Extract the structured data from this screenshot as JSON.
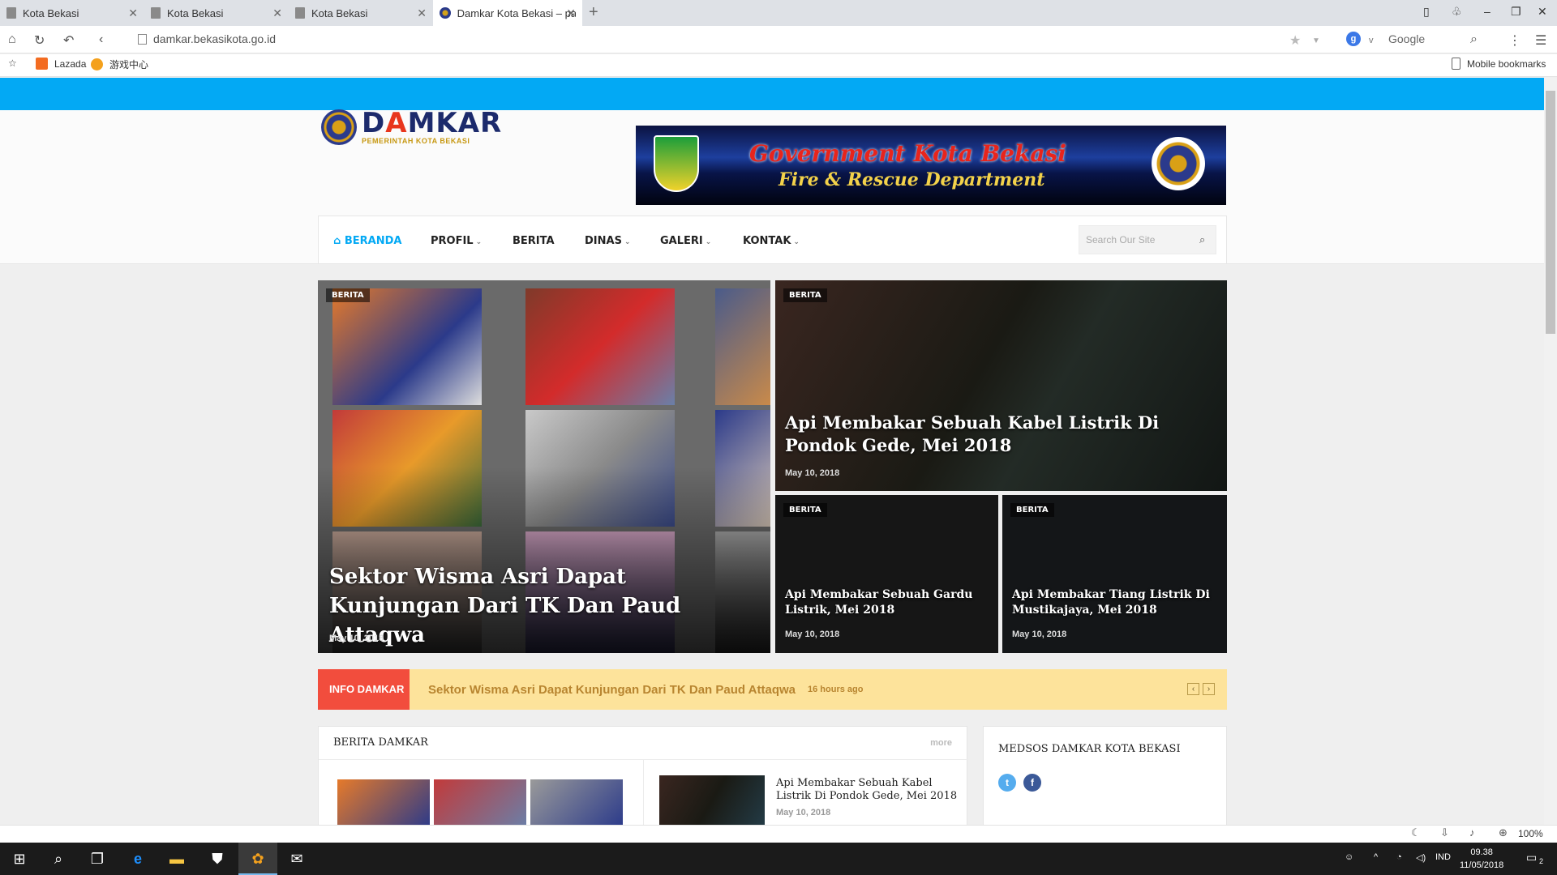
{
  "browser": {
    "tabs": [
      {
        "title": "Kota Bekasi"
      },
      {
        "title": "Kota Bekasi"
      },
      {
        "title": "Kota Bekasi"
      },
      {
        "title": "Damkar Kota Bekasi – pantang"
      }
    ],
    "url": "damkar.bekasikota.go.id",
    "search_engine": "Google",
    "bookmarks": [
      {
        "label": "Lazada"
      },
      {
        "label": "游戏中心"
      }
    ],
    "mobile_bookmarks": "Mobile bookmarks",
    "zoom": "100%"
  },
  "site": {
    "logo_title": "DAMKAR",
    "logo_subtitle": "PEMERINTAH KOTA BEKASI",
    "banner_line1": "Government Kota Bekasi",
    "banner_line2": "Fire & Rescue Department",
    "nav": [
      {
        "label": "BERANDA",
        "active": true,
        "dropdown": false
      },
      {
        "label": "PROFIL",
        "dropdown": true
      },
      {
        "label": "BERITA",
        "dropdown": false
      },
      {
        "label": "DINAS",
        "dropdown": true
      },
      {
        "label": "GALERI",
        "dropdown": true
      },
      {
        "label": "KONTAK",
        "dropdown": true
      }
    ],
    "search_placeholder": "Search Our Site",
    "featured": [
      {
        "tag": "BERITA",
        "title": "Sektor Wisma Asri Dapat Kunjungan Dari TK Dan Paud Attaqwa",
        "date": "May 10, 2018"
      },
      {
        "tag": "BERITA",
        "title": "Api Membakar Sebuah Kabel Listrik Di Pondok Gede, Mei 2018",
        "date": "May 10, 2018"
      },
      {
        "tag": "BERITA",
        "title": "Api Membakar Sebuah Gardu Listrik, Mei 2018",
        "date": "May 10, 2018"
      },
      {
        "tag": "BERITA",
        "title": "Api Membakar Tiang Listrik Di Mustikajaya, Mei 2018",
        "date": "May 10, 2018"
      }
    ],
    "ticker": {
      "label": "INFO DAMKAR",
      "text": "Sektor Wisma Asri Dapat Kunjungan Dari TK Dan Paud Attaqwa",
      "time": "16 hours ago"
    },
    "berita_panel": {
      "title": "BERITA DAMKAR",
      "more": "more",
      "item_title": "Api Membakar Sebuah Kabel Listrik Di Pondok Gede, Mei 2018",
      "item_date": "May 10, 2018"
    },
    "medsos_panel": {
      "title": "MEDSOS DAMKAR KOTA BEKASI"
    }
  },
  "taskbar": {
    "lang": "IND",
    "time": "09.38",
    "date": "11/05/2018",
    "notifications": "2"
  },
  "colors": {
    "accent": "#03a9f4",
    "ticker_label": "#f24d3d",
    "ticker_bg": "#fde39b"
  }
}
